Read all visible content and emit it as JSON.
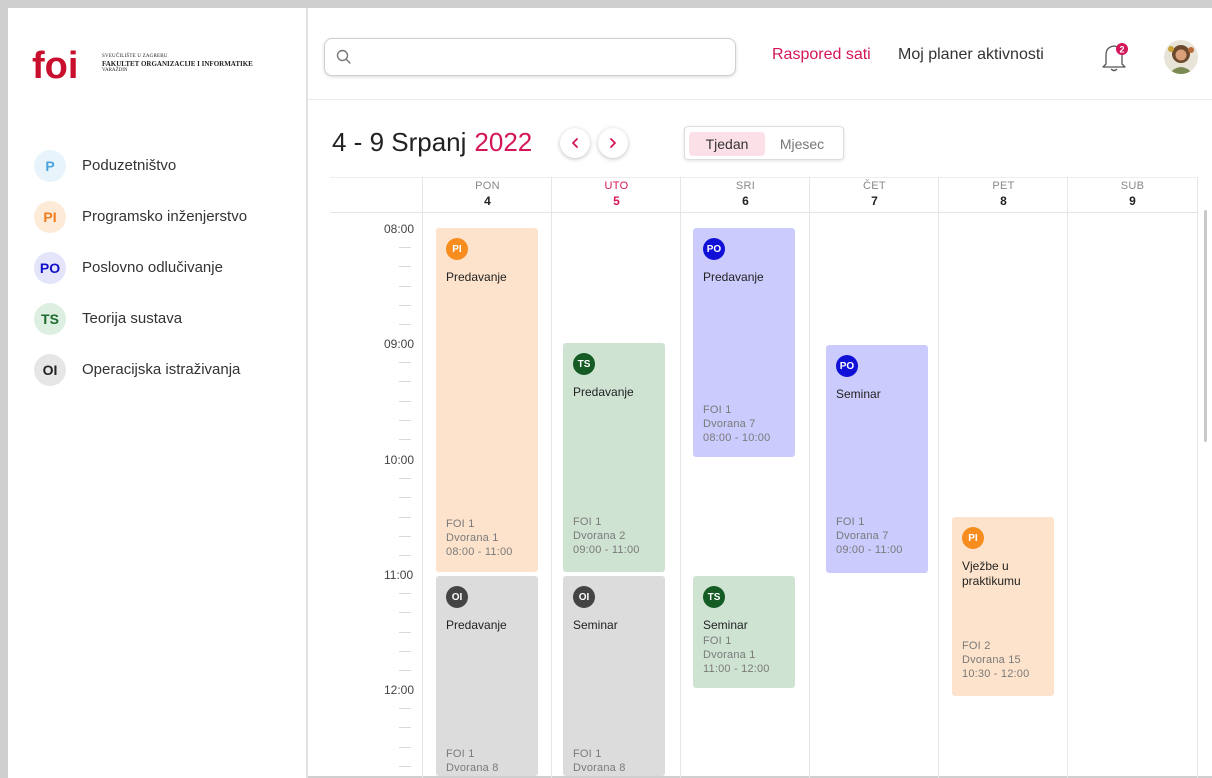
{
  "logo": {
    "brand": "foi",
    "line1": "SVEUČILIŠTE U ZAGREBU",
    "line2": "FAKULTET ORGANIZACIJE I INFORMATIKE",
    "line3": "VARAŽDIN"
  },
  "courses": [
    {
      "code": "P",
      "label": "Poduzetništvo",
      "bg": "#e8f4fb",
      "fg": "#4aa3df"
    },
    {
      "code": "PI",
      "label": "Programsko inženjerstvo",
      "bg": "#fdebd8",
      "fg": "#f07c1c"
    },
    {
      "code": "PO",
      "label": "Poslovno odlučivanje",
      "bg": "#e4e4fb",
      "fg": "#1010c8"
    },
    {
      "code": "TS",
      "label": "Teorija sustava",
      "bg": "#dcefe0",
      "fg": "#1c6b2c"
    },
    {
      "code": "OI",
      "label": "Operacijska istraživanja",
      "bg": "#e6e6e6",
      "fg": "#222222"
    }
  ],
  "search": {
    "placeholder": ""
  },
  "nav": {
    "schedule": "Raspored sati",
    "planner": "Moj planer aktivnosti"
  },
  "notifications": {
    "count": "2"
  },
  "calendar": {
    "title": "4 - 9 Srpanj",
    "year": "2022",
    "view_week": "Tjedan",
    "view_month": "Mjesec",
    "days": [
      {
        "name": "PON",
        "num": "4"
      },
      {
        "name": "UTO",
        "num": "5"
      },
      {
        "name": "SRI",
        "num": "6"
      },
      {
        "name": "ČET",
        "num": "7"
      },
      {
        "name": "PET",
        "num": "8"
      },
      {
        "name": "SUB",
        "num": "9"
      }
    ],
    "times": [
      "08:00",
      "09:00",
      "10:00",
      "11:00",
      "12:00"
    ]
  },
  "events": [
    {
      "badge": "PI",
      "title": "Predavanje",
      "info": [
        "FOI 1",
        "Dvorana 1",
        "08:00 - 11:00"
      ]
    },
    {
      "badge": "OI",
      "title": "Predavanje",
      "info": [
        "FOI 1",
        "Dvorana 8"
      ]
    },
    {
      "badge": "TS",
      "title": "Predavanje",
      "info": [
        "FOI 1",
        "Dvorana 2",
        "09:00 - 11:00"
      ]
    },
    {
      "badge": "OI",
      "title": "Seminar",
      "info": [
        "FOI 1",
        "Dvorana 8"
      ]
    },
    {
      "badge": "PO",
      "title": "Predavanje",
      "info": [
        "FOI 1",
        "Dvorana 7",
        "08:00 - 10:00"
      ]
    },
    {
      "badge": "TS",
      "title": "Seminar",
      "info": [
        "FOI 1",
        "Dvorana 1",
        "11:00 - 12:00"
      ]
    },
    {
      "badge": "PO",
      "title": "Seminar",
      "info": [
        "FOI 1",
        "Dvorana 7",
        "09:00 - 11:00"
      ]
    },
    {
      "badge": "PI",
      "title": "Vježbe u praktikumu",
      "info": [
        "FOI 2",
        "Dvorana 15",
        "10:30 - 12:00"
      ]
    }
  ],
  "colors": {
    "accent": "#d4155a",
    "pi_event": "#fde3cb",
    "po_event": "#cbcbfd",
    "ts_event": "#cfe3d3",
    "oi_event": "#dcdcdc"
  }
}
